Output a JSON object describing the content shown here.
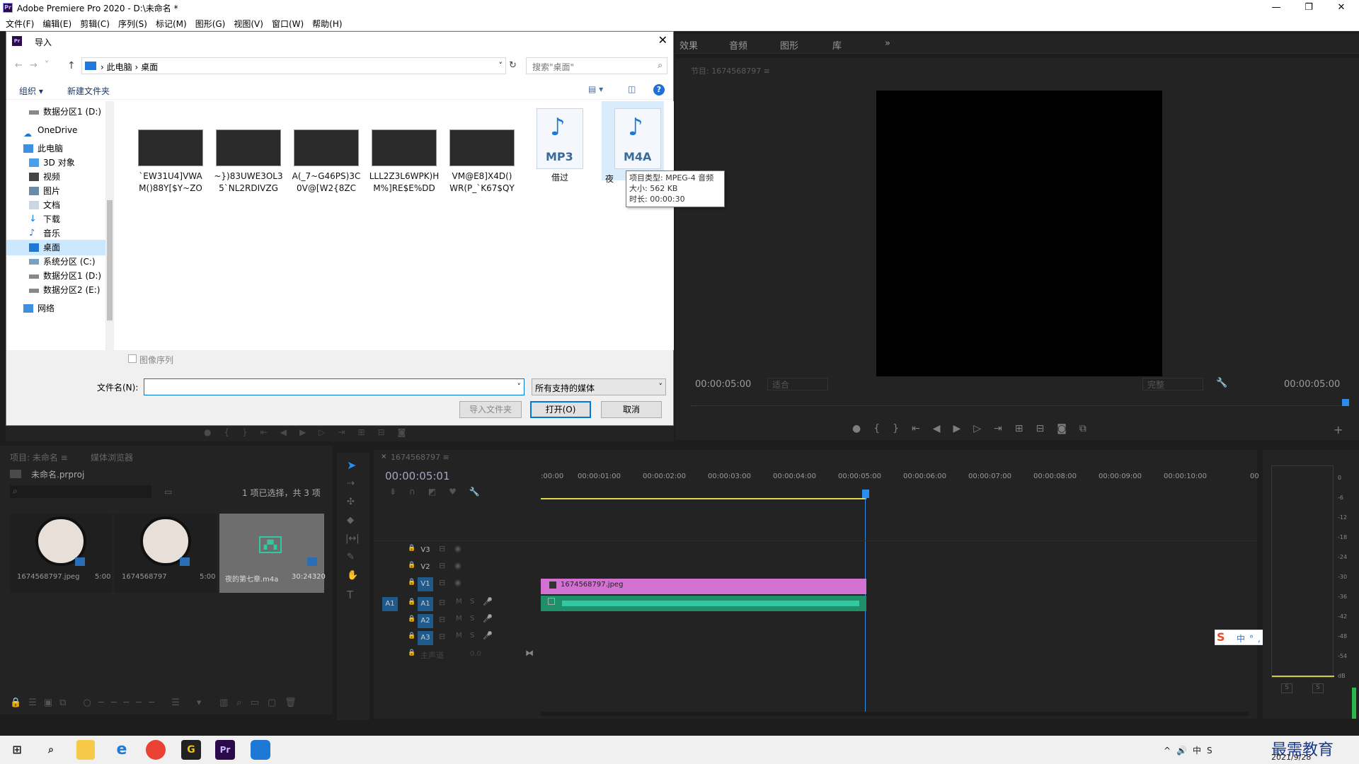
{
  "app": {
    "title": "Adobe Premiere Pro 2020 - D:\\未命名 *",
    "logo": "Pr",
    "window_buttons": [
      "—",
      "❐",
      "✕"
    ]
  },
  "menu": [
    "文件(F)",
    "编辑(E)",
    "剪辑(C)",
    "序列(S)",
    "标记(M)",
    "图形(G)",
    "视图(V)",
    "窗口(W)",
    "帮助(H)"
  ],
  "effects_tabs": [
    "效果",
    "音频",
    "图形",
    "库",
    "»"
  ],
  "program_monitor": {
    "title": "节目: 1674568797 ≡",
    "timecode_left": "00:00:05:00",
    "fit": "适合",
    "quality": "完整",
    "timecode_right": "00:00:05:00"
  },
  "dialog": {
    "title": "导入",
    "breadcrumb": [
      "此电脑",
      "桌面"
    ],
    "search_placeholder": "搜索\"桌面\"",
    "organize": "组织 ▾",
    "new_folder": "新建文件夹",
    "help": "?",
    "nav": [
      {
        "label": "数据分区1 (D:)",
        "icon": "drive-icon"
      },
      {
        "label": "OneDrive",
        "icon": "cloud-icon"
      },
      {
        "label": "此电脑",
        "icon": "computer-icon"
      },
      {
        "label": "3D 对象",
        "icon": "cube-icon"
      },
      {
        "label": "视频",
        "icon": "video-icon"
      },
      {
        "label": "图片",
        "icon": "picture-icon"
      },
      {
        "label": "文档",
        "icon": "document-icon"
      },
      {
        "label": "下载",
        "icon": "download-icon"
      },
      {
        "label": "音乐",
        "icon": "music-icon"
      },
      {
        "label": "桌面",
        "icon": "desktop-icon"
      },
      {
        "label": "系统分区 (C:)",
        "icon": "drive-icon"
      },
      {
        "label": "数据分区1 (D:)",
        "icon": "drive-icon"
      },
      {
        "label": "数据分区2 (E:)",
        "icon": "drive-icon"
      },
      {
        "label": "网络",
        "icon": "network-icon"
      }
    ],
    "files": [
      {
        "line1": "`EW31U4]VWA",
        "line2": "M()88Y[$Y~ZO"
      },
      {
        "line1": "~})83UWE3OL3",
        "line2": "5`NL2RDIVZG"
      },
      {
        "line1": "A(_7~G46PS)3C",
        "line2": "0V@[W2{8ZC"
      },
      {
        "line1": "LLL2Z3L6WPK)H",
        "line2": "M%]RE$E%DD"
      },
      {
        "line1": "VM@E8]X4D()",
        "line2": "WR(P_`K67$QY"
      },
      {
        "line1": "借过",
        "line2": "",
        "badge": "MP3"
      },
      {
        "line1": "夜",
        "line2": "",
        "badge": "M4A"
      }
    ],
    "tooltip": [
      "项目类型: MPEG-4 音频",
      "大小: 562 KB",
      "时长: 00:00:30"
    ],
    "image_sequence": "图像序列",
    "filename_label": "文件名(N):",
    "filename_value": "",
    "filetype": "所有支持的媒体",
    "import_folder": "导入文件夹",
    "open": "打开(O)",
    "cancel": "取消"
  },
  "project": {
    "tab": "项目: 未命名 ≡",
    "tab2": "媒体浏览器",
    "file": "未命名.prproj",
    "status": "1 项已选择，共 3 项",
    "items": [
      {
        "name": "1674568797.jpeg",
        "dur": "5:00"
      },
      {
        "name": "1674568797",
        "dur": "5:00"
      },
      {
        "name": "夜的第七章.m4a",
        "dur": "30:24320"
      }
    ]
  },
  "timeline": {
    "tab": "1674568797 ≡",
    "timecode": "00:00:05:01",
    "ruler": [
      ":00:00",
      "00:00:01:00",
      "00:00:02:00",
      "00:00:03:00",
      "00:00:04:00",
      "00:00:05:00",
      "00:00:06:00",
      "00:00:07:00",
      "00:00:08:00",
      "00:00:09:00",
      "00:00:10:00",
      "00"
    ],
    "tracks": [
      "V3",
      "V2",
      "V1",
      "A1",
      "A2",
      "A3"
    ],
    "master": "主声道",
    "master_val": "0.0",
    "clip_name": "1674568797.jpeg",
    "video_clip_color": "#d371d3",
    "audio_clip_color": "#1f8f6a"
  },
  "meter": {
    "scale": [
      "0",
      "-6",
      "-12",
      "-18",
      "-24",
      "-30",
      "-36",
      "-42",
      "-48",
      "-54",
      "dB"
    ],
    "buttons": [
      "S",
      "S"
    ]
  },
  "ime": [
    "中",
    "°,",
    "☺",
    "🎤",
    "⌨",
    "👤",
    "👕",
    "⁘"
  ],
  "taskbar": {
    "date": "2021/9/28",
    "watermark": "最需教育",
    "tray": [
      "^",
      "🔊",
      "中",
      "S"
    ]
  }
}
